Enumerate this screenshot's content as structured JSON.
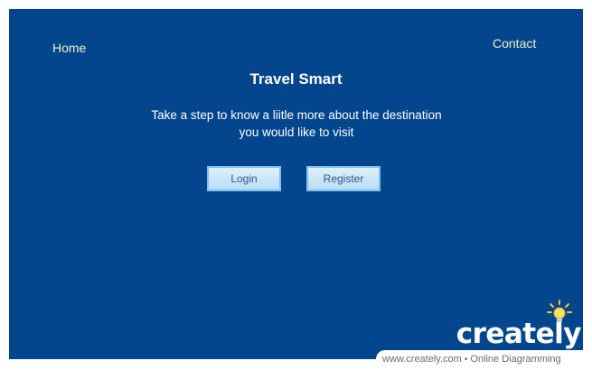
{
  "nav": {
    "home_label": "Home",
    "contact_label": "Contact"
  },
  "hero": {
    "title": "Travel Smart",
    "subtitle_line1": "Take a step to know a liitle more about the destination",
    "subtitle_line2": "you would like to visit"
  },
  "actions": {
    "login_label": "Login",
    "register_label": "Register"
  },
  "watermark": {
    "logo_text": "creately",
    "url_text": "www.creately.com",
    "tagline": "Online Diagramming",
    "separator": "•"
  },
  "colors": {
    "panel_background": "#03468e",
    "nav_text": "#f3f0c6",
    "button_fill": "#cbe7f8",
    "button_border": "#7fc1f2"
  },
  "icons": {
    "bulb": "lightbulb-icon"
  }
}
